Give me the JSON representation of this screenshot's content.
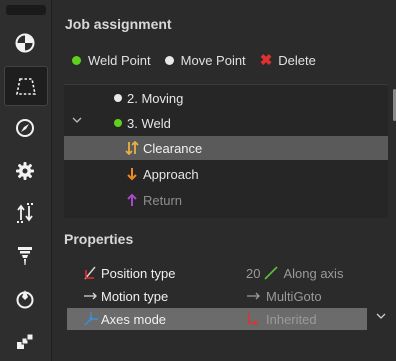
{
  "panel": {
    "title": "Job assignment",
    "filters": [
      {
        "label": "Weld Point",
        "color": "#5fd11d"
      },
      {
        "label": "Move Point",
        "color": "#e8e8e8"
      },
      {
        "label": "Delete",
        "color": "#e23030"
      }
    ]
  },
  "tree": {
    "items": [
      {
        "label": "2. Moving",
        "dot": "#e8e8e8"
      },
      {
        "label": "3. Weld",
        "dot": "#5fd11d",
        "expanded": true
      },
      {
        "label": "Clearance",
        "icon": "clearance-icon",
        "color": "#e8b043",
        "selected": true
      },
      {
        "label": "Approach",
        "icon": "arrow-down-icon",
        "color": "#ef8a1f"
      },
      {
        "label": "Return",
        "icon": "arrow-up-icon",
        "color": "#a64ac9"
      }
    ]
  },
  "properties": {
    "title": "Properties",
    "rows": [
      {
        "label": "Position type",
        "value_number": "20",
        "value": "Along axis"
      },
      {
        "label": "Motion type",
        "value": "MultiGoto"
      },
      {
        "label": "Axes mode",
        "value": "Inherited"
      }
    ]
  }
}
